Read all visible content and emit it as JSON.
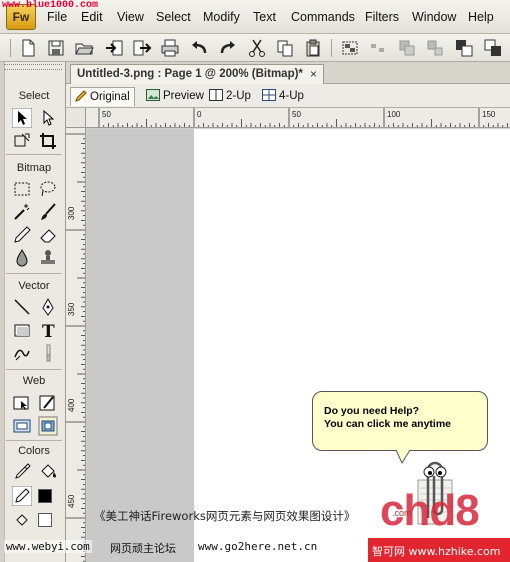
{
  "app": {
    "logo": "Fw",
    "watermark_top": "www.blue1000.com"
  },
  "menu": [
    "File",
    "Edit",
    "View",
    "Select",
    "Modify",
    "Text",
    "Commands",
    "Filters",
    "Window",
    "Help"
  ],
  "toolbar": {
    "icons": [
      "new-icon",
      "save-icon",
      "open-icon",
      "import-icon",
      "export-icon",
      "print-icon",
      "undo-icon",
      "redo-icon",
      "cut-icon",
      "copy-icon",
      "paste-icon",
      "group-icon",
      "ungroup-icon",
      "join-icon",
      "split-icon",
      "send-back-icon",
      "bring-front-icon"
    ]
  },
  "tools": {
    "sections": [
      "Select",
      "Bitmap",
      "Vector",
      "Web",
      "Colors"
    ]
  },
  "document": {
    "tab_title": "Untitled-3.png : Page 1 @ 200% (Bitmap)*",
    "close_glyph": "×"
  },
  "views": {
    "original": "Original",
    "preview": "Preview",
    "two_up": "2-Up",
    "four_up": "4-Up"
  },
  "rulers": {
    "h_labels": [
      "50",
      "0",
      "50",
      "100",
      "150"
    ],
    "v_labels": [
      "300",
      "350",
      "400",
      "450"
    ]
  },
  "help_balloon": {
    "line1": "Do you need Help?",
    "line2": "You can click me anytime"
  },
  "watermarks": {
    "book": "《美工神话Fireworks网页元素与网页效果图设计》",
    "site1": "www.webyi.com",
    "site2": "网页顽主论坛",
    "site3": "www.go2here.net.cn",
    "chd8": "chd8",
    "chd8_com": ".com",
    "hzhike": "智可网 www.hzhike.com"
  },
  "colors": {
    "stroke": "#000000",
    "fill": "#ffffff",
    "accent": "#e2252e"
  }
}
